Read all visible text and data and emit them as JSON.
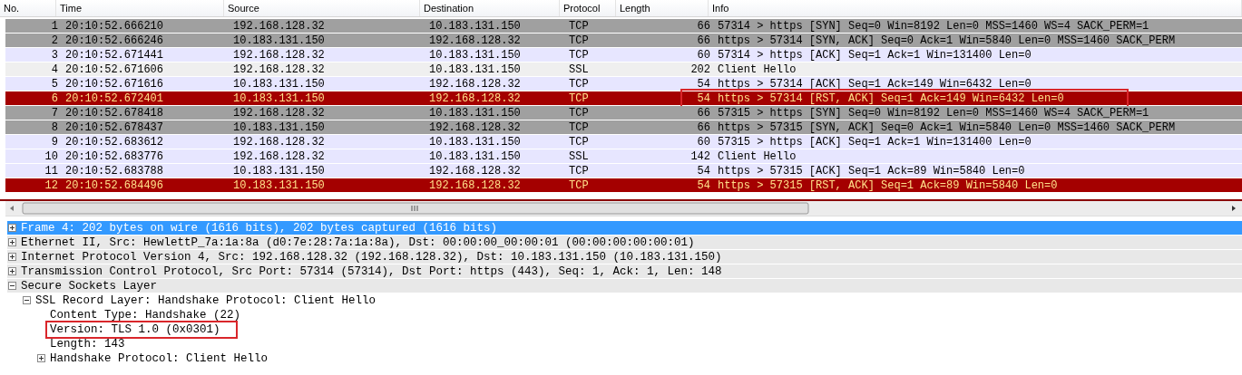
{
  "columns": [
    "No.",
    "Time",
    "Source",
    "Destination",
    "Protocol",
    "Length",
    "Info"
  ],
  "packets": [
    {
      "no": "1",
      "time": "20:10:52.666210",
      "source": "192.168.128.32",
      "destination": "10.183.131.150",
      "protocol": "TCP",
      "length": "66",
      "info": "57314 > https [SYN] Seq=0 Win=8192 Len=0 MSS=1460 WS=4 SACK_PERM=1",
      "color": "#a0a0a0",
      "selected": false,
      "highlighted": false
    },
    {
      "no": "2",
      "time": "20:10:52.666246",
      "source": "10.183.131.150",
      "destination": "192.168.128.32",
      "protocol": "TCP",
      "length": "66",
      "info": "https > 57314 [SYN, ACK] Seq=0 Ack=1 Win=5840 Len=0 MSS=1460 SACK_PERM",
      "color": "#a0a0a0",
      "selected": false,
      "highlighted": false
    },
    {
      "no": "3",
      "time": "20:10:52.671441",
      "source": "192.168.128.32",
      "destination": "10.183.131.150",
      "protocol": "TCP",
      "length": "60",
      "info": "57314 > https [ACK] Seq=1 Ack=1 Win=131400 Len=0",
      "color": "#e7e6ff",
      "selected": false,
      "highlighted": false
    },
    {
      "no": "4",
      "time": "20:10:52.671606",
      "source": "192.168.128.32",
      "destination": "10.183.131.150",
      "protocol": "SSL",
      "length": "202",
      "info": "Client Hello",
      "color": "#efefef",
      "selected": false,
      "highlighted": false
    },
    {
      "no": "5",
      "time": "20:10:52.671616",
      "source": "10.183.131.150",
      "destination": "192.168.128.32",
      "protocol": "TCP",
      "length": "54",
      "info": "https > 57314 [ACK] Seq=1 Ack=149 Win=6432 Len=0",
      "color": "#e7e6ff",
      "selected": false,
      "highlighted": false
    },
    {
      "no": "6",
      "time": "20:10:52.672401",
      "source": "10.183.131.150",
      "destination": "192.168.128.32",
      "protocol": "TCP",
      "length": "54",
      "info": "https > 57314 [RST, ACK] Seq=1 Ack=149 Win=6432 Len=0",
      "color": "#a40000",
      "selected": false,
      "highlighted": true
    },
    {
      "no": "7",
      "time": "20:10:52.678418",
      "source": "192.168.128.32",
      "destination": "10.183.131.150",
      "protocol": "TCP",
      "length": "66",
      "info": "57315 > https [SYN] Seq=0 Win=8192 Len=0 MSS=1460 WS=4 SACK_PERM=1",
      "color": "#a0a0a0",
      "selected": false,
      "highlighted": false
    },
    {
      "no": "8",
      "time": "20:10:52.678437",
      "source": "10.183.131.150",
      "destination": "192.168.128.32",
      "protocol": "TCP",
      "length": "66",
      "info": "https > 57315 [SYN, ACK] Seq=0 Ack=1 Win=5840 Len=0 MSS=1460 SACK_PERM",
      "color": "#a0a0a0",
      "selected": false,
      "highlighted": false
    },
    {
      "no": "9",
      "time": "20:10:52.683612",
      "source": "192.168.128.32",
      "destination": "10.183.131.150",
      "protocol": "TCP",
      "length": "60",
      "info": "57315 > https [ACK] Seq=1 Ack=1 Win=131400 Len=0",
      "color": "#e7e6ff",
      "selected": false,
      "highlighted": false
    },
    {
      "no": "10",
      "time": "20:10:52.683776",
      "source": "192.168.128.32",
      "destination": "10.183.131.150",
      "protocol": "SSL",
      "length": "142",
      "info": "Client Hello",
      "color": "#e7e6ff",
      "selected": false,
      "highlighted": false
    },
    {
      "no": "11",
      "time": "20:10:52.683788",
      "source": "10.183.131.150",
      "destination": "192.168.128.32",
      "protocol": "TCP",
      "length": "54",
      "info": "https > 57315 [ACK] Seq=1 Ack=89 Win=5840 Len=0",
      "color": "#e7e6ff",
      "selected": false,
      "highlighted": false
    },
    {
      "no": "12",
      "time": "20:10:52.684496",
      "source": "10.183.131.150",
      "destination": "192.168.128.32",
      "protocol": "TCP",
      "length": "54",
      "info": "https > 57315 [RST, ACK] Seq=1 Ack=89 Win=5840 Len=0",
      "color": "#a40000",
      "selected": false,
      "highlighted": false
    }
  ],
  "details": [
    {
      "label": "Frame 4: 202 bytes on wire (1616 bits), 202 bytes captured (1616 bits)",
      "selected": true,
      "expanded": false,
      "highlighted": false
    },
    {
      "label": "Ethernet II, Src: HewlettP_7a:1a:8a (d0:7e:28:7a:1a:8a), Dst: 00:00:00_00:00:01 (00:00:00:00:00:01)",
      "selected": false,
      "expanded": false,
      "highlighted": false
    },
    {
      "label": "Internet Protocol Version 4, Src: 192.168.128.32 (192.168.128.32), Dst: 10.183.131.150 (10.183.131.150)",
      "selected": false,
      "expanded": false,
      "highlighted": false
    },
    {
      "label": "Transmission Control Protocol, Src Port: 57314 (57314), Dst Port: https (443), Seq: 1, Ack: 1, Len: 148",
      "selected": false,
      "expanded": false,
      "highlighted": false
    },
    {
      "label": "Secure Sockets Layer",
      "selected": false,
      "expanded": true,
      "highlighted": false,
      "children": [
        {
          "label": "SSL Record Layer: Handshake Protocol: Client Hello",
          "selected": false,
          "expanded": true,
          "highlighted": false,
          "children": [
            {
              "label": "Content Type: Handshake (22)",
              "selected": false,
              "highlighted": false
            },
            {
              "label": "Version: TLS 1.0 (0x0301)",
              "selected": false,
              "highlighted": true
            },
            {
              "label": "Length: 143",
              "selected": false,
              "highlighted": false
            },
            {
              "label": "Handshake Protocol: Client Hello",
              "selected": false,
              "expanded": false,
              "highlighted": false
            }
          ]
        }
      ]
    }
  ]
}
